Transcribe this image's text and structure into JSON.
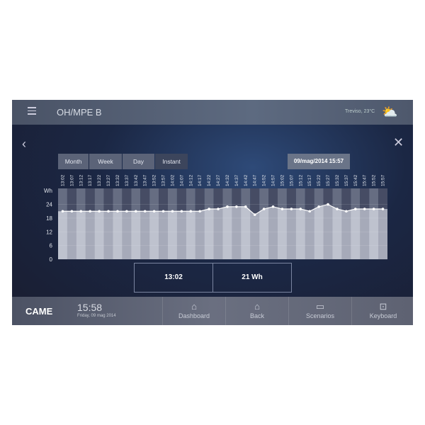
{
  "header": {
    "title": "OH/MPE B",
    "weather": "Treviso, 23°C",
    "icons": {
      "menu": "menu-icon",
      "weather": "partly-cloudy-icon",
      "back": "chevron-left-icon",
      "close": "close-icon"
    }
  },
  "tabs": [
    {
      "label": "Month"
    },
    {
      "label": "Week"
    },
    {
      "label": "Day"
    },
    {
      "label": "Instant",
      "active": true
    }
  ],
  "selected_datetime": "09/mag/2014 15:57",
  "readout": {
    "time": "13:02",
    "value": "21 Wh"
  },
  "chart_data": {
    "type": "area",
    "ylabel": "Wh",
    "ylim": [
      0,
      31
    ],
    "yticks": [
      0,
      6,
      12,
      18,
      24
    ],
    "x": [
      "13:02",
      "13:07",
      "13:12",
      "13:17",
      "13:22",
      "13:27",
      "13:32",
      "13:37",
      "13:42",
      "13:47",
      "13:52",
      "13:57",
      "14:02",
      "14:07",
      "14:12",
      "14:17",
      "14:22",
      "14:27",
      "14:32",
      "14:37",
      "14:42",
      "14:47",
      "14:52",
      "14:57",
      "15:02",
      "15:07",
      "15:12",
      "15:17",
      "15:22",
      "15:27",
      "15:32",
      "15:37",
      "15:42",
      "15:47",
      "15:52",
      "15:57"
    ],
    "values": [
      21,
      21,
      21,
      21,
      21,
      21,
      21,
      21,
      21,
      21,
      21,
      21,
      21,
      21,
      21,
      21,
      22,
      22,
      23,
      23,
      23,
      19.5,
      22,
      23,
      22,
      22,
      22,
      21,
      23,
      24,
      22,
      21,
      22,
      22,
      22,
      22
    ]
  },
  "footer": {
    "brand": "CAME",
    "time": "15:58",
    "date": "Friday, 09 mag 2014",
    "nav": [
      {
        "label": "Dashboard",
        "icon": "home-icon"
      },
      {
        "label": "Back",
        "icon": "home-icon"
      },
      {
        "label": "Scenarios",
        "icon": "scenarios-icon"
      },
      {
        "label": "Keyboard",
        "icon": "keypad-icon"
      }
    ]
  }
}
